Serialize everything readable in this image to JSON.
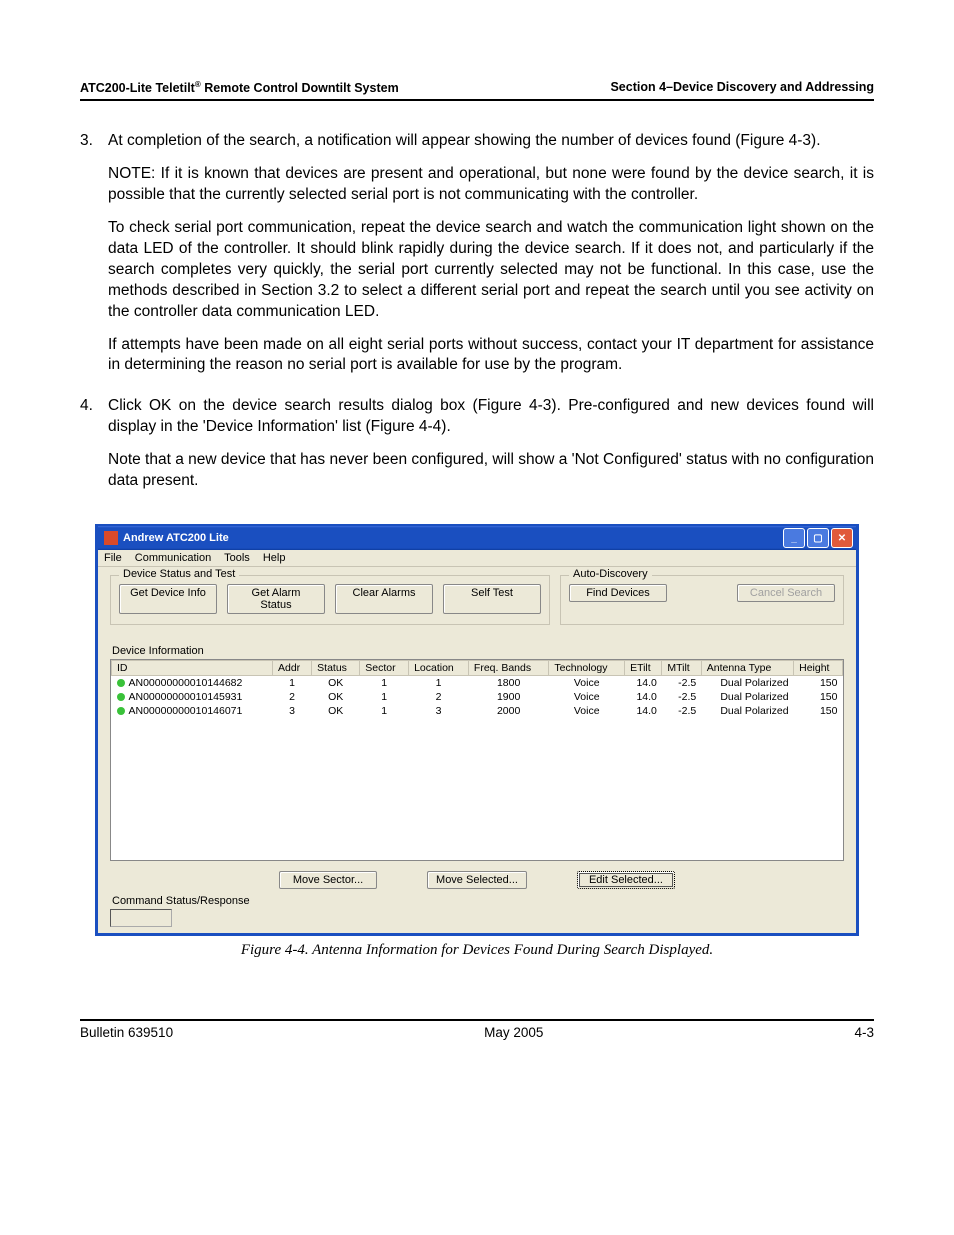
{
  "header": {
    "left_prefix": "ATC200-Lite Teletilt",
    "left_suffix": " Remote Control Downtilt System",
    "right": "Section 4–Device Discovery and Addressing"
  },
  "body": {
    "items": [
      {
        "num": "3.",
        "paras": [
          "At completion of the search, a notification will appear showing the number of devices found (Figure 4-3).",
          "NOTE: If it is known that devices are present and operational, but none were found by the device search, it is possible that the currently selected serial port is not communicating with the controller.",
          "To check serial port communication, repeat the device search and watch the communication light shown on the data LED of the controller. It should blink rapidly during the device search. If it does not, and particularly if the search completes very quickly, the serial port currently selected may not be functional. In this case, use the methods described in Section 3.2 to select a different serial port and repeat the search until you see activity on the controller data communication LED.",
          "If attempts have been made on all eight serial ports without success, contact your IT department for assistance in determining the reason no serial port is available for use by the program."
        ]
      },
      {
        "num": "4.",
        "paras": [
          "Click OK on the device search results dialog box (Figure 4-3). Pre-configured and new devices found will display in the 'Device Information' list (Figure 4-4).",
          "Note that a new device that has never been configured, will show a 'Not Configured' status with no configuration data present."
        ]
      }
    ]
  },
  "app": {
    "title": "Andrew ATC200 Lite",
    "menu": [
      "File",
      "Communication",
      "Tools",
      "Help"
    ],
    "group_status_test": "Device Status and Test",
    "group_auto": "Auto-Discovery",
    "buttons": {
      "get_device_info": "Get Device Info",
      "get_alarm_status": "Get Alarm Status",
      "clear_alarms": "Clear Alarms",
      "self_test": "Self Test",
      "find_devices": "Find Devices",
      "cancel_search": "Cancel Search",
      "move_sector": "Move Sector...",
      "move_selected": "Move Selected...",
      "edit_selected": "Edit Selected..."
    },
    "dev_info_label": "Device Information",
    "table": {
      "headers": [
        "ID",
        "Addr",
        "Status",
        "Sector",
        "Location",
        "Freq. Bands",
        "Technology",
        "ETilt",
        "MTilt",
        "Antenna Type",
        "Height"
      ],
      "rows": [
        {
          "id": "AN00000000010144682",
          "addr": "1",
          "status": "OK",
          "sector": "1",
          "location": "1",
          "freq": "1800",
          "tech": "Voice",
          "etilt": "14.0",
          "mtilt": "-2.5",
          "ant": "Dual Polarized",
          "height": "150"
        },
        {
          "id": "AN00000000010145931",
          "addr": "2",
          "status": "OK",
          "sector": "1",
          "location": "2",
          "freq": "1900",
          "tech": "Voice",
          "etilt": "14.0",
          "mtilt": "-2.5",
          "ant": "Dual Polarized",
          "height": "150"
        },
        {
          "id": "AN00000000010146071",
          "addr": "3",
          "status": "OK",
          "sector": "1",
          "location": "3",
          "freq": "2000",
          "tech": "Voice",
          "etilt": "14.0",
          "mtilt": "-2.5",
          "ant": "Dual Polarized",
          "height": "150"
        }
      ]
    },
    "cmd_status_label": "Command Status/Response"
  },
  "caption": "Figure 4-4. Antenna Information for Devices Found During Search Displayed.",
  "footer": {
    "left": "Bulletin 639510",
    "center": "May 2005",
    "right": "4-3"
  }
}
